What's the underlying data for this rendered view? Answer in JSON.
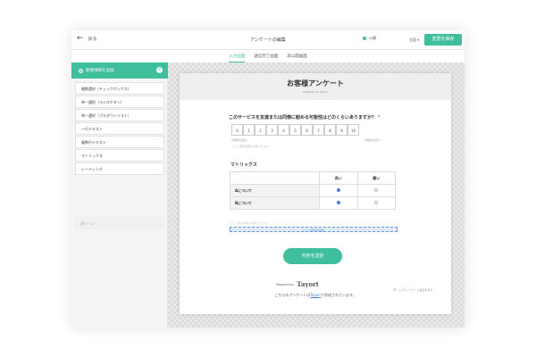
{
  "header": {
    "back_label": "戻る",
    "title": "アンケートの編集",
    "status_label": "公開",
    "lang_label": "言語 ▾",
    "save_label": "変更を保存"
  },
  "tabs": [
    {
      "label": "入力画面",
      "active": true
    },
    {
      "label": "送信完了画面",
      "active": false
    },
    {
      "label": "非公開画面",
      "active": false
    }
  ],
  "sidebar": {
    "add_label": "新規項目を追加",
    "items": [
      "複数選択（チェックボックス）",
      "単一選択（ラジオボタン）",
      "単一選択（プルダウンリスト）",
      "一行テキスト",
      "複数行テキスト",
      "マトリックス",
      "レーティング"
    ],
    "page_label": "改ページ"
  },
  "form": {
    "title": "お客様アンケート",
    "powered": "Powered by Tayori",
    "question1": "このサービスを友達または同僚に勧める可能性はどのくらいありますか？",
    "required_mark": "*",
    "scale": [
      "0",
      "1",
      "2",
      "3",
      "4",
      "5",
      "6",
      "7",
      "8",
      "9",
      "10"
    ],
    "scale_low": "可能性は低い",
    "scale_high": "可能性は高い",
    "question1_hint": "ここに補足説明を記載できます",
    "matrix_title": "マトリックス",
    "matrix_cols": [
      "良い",
      "悪い"
    ],
    "matrix_rows": [
      "Aについて",
      "Bについて"
    ],
    "matrix_hint": "ここに補足説明を記載できます",
    "drop_label": "ここへ項目を移動",
    "submit_label": "内容を送信",
    "powered_by_label": "Powered by",
    "logo_text": "Tayori",
    "footer_pre": "こちらのアンケートは",
    "footer_link": "Tayori",
    "footer_post": "で作成されています。",
    "template_note": "このテンプレート設定を見る"
  },
  "colors": {
    "accent": "#3fbf9c",
    "radio_selected": "#3f7fe0"
  }
}
